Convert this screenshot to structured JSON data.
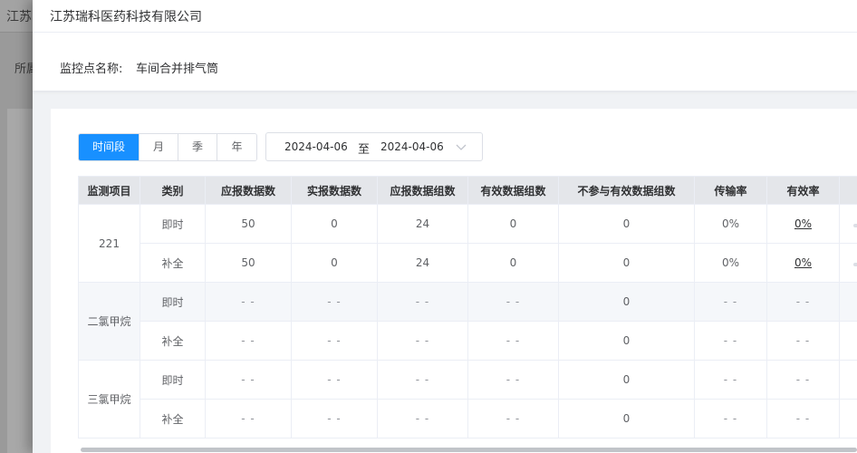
{
  "background": {
    "title": "江苏",
    "filter_label": "所属"
  },
  "drawer": {
    "title": "江苏瑞科医药科技有限公司",
    "monitor_point_label": "监控点名称:",
    "monitor_point_value": "车间合并排气筒"
  },
  "period_tabs": [
    {
      "label": "时间段",
      "active": true
    },
    {
      "label": "月",
      "active": false
    },
    {
      "label": "季",
      "active": false
    },
    {
      "label": "年",
      "active": false
    }
  ],
  "date_range": {
    "start": "2024-04-06",
    "separator": "至",
    "end": "2024-04-06"
  },
  "table": {
    "columns": [
      "监测项目",
      "类别",
      "应报数据数",
      "实报数据数",
      "应报数据组数",
      "有效数据组数",
      "不参与有效数据组数",
      "传输率",
      "有效率"
    ],
    "groups": [
      {
        "item": "221",
        "rows": [
          {
            "category": "即时",
            "should": "50",
            "actual": "0",
            "should_groups": "24",
            "valid_groups": "0",
            "excluded_groups": "0",
            "transmit_rate": "0%",
            "valid_rate": "0%"
          },
          {
            "category": "补全",
            "should": "50",
            "actual": "0",
            "should_groups": "24",
            "valid_groups": "0",
            "excluded_groups": "0",
            "transmit_rate": "0%",
            "valid_rate": "0%"
          }
        ]
      },
      {
        "item": "二氯甲烷",
        "rows": [
          {
            "category": "即时",
            "should": "- -",
            "actual": "- -",
            "should_groups": "- -",
            "valid_groups": "- -",
            "excluded_groups": "0",
            "transmit_rate": "- -",
            "valid_rate": "- -"
          },
          {
            "category": "补全",
            "should": "- -",
            "actual": "- -",
            "should_groups": "- -",
            "valid_groups": "- -",
            "excluded_groups": "0",
            "transmit_rate": "- -",
            "valid_rate": "- -"
          }
        ]
      },
      {
        "item": "三氯甲烷",
        "rows": [
          {
            "category": "即时",
            "should": "- -",
            "actual": "- -",
            "should_groups": "- -",
            "valid_groups": "- -",
            "excluded_groups": "0",
            "transmit_rate": "- -",
            "valid_rate": "- -"
          },
          {
            "category": "补全",
            "should": "- -",
            "actual": "- -",
            "should_groups": "- -",
            "valid_groups": "- -",
            "excluded_groups": "0",
            "transmit_rate": "- -",
            "valid_rate": "- -"
          }
        ]
      }
    ]
  },
  "colors": {
    "accent": "#1890ff",
    "header_bg": "#e4e6ea",
    "row_alt_bg": "#f5f7fa"
  }
}
